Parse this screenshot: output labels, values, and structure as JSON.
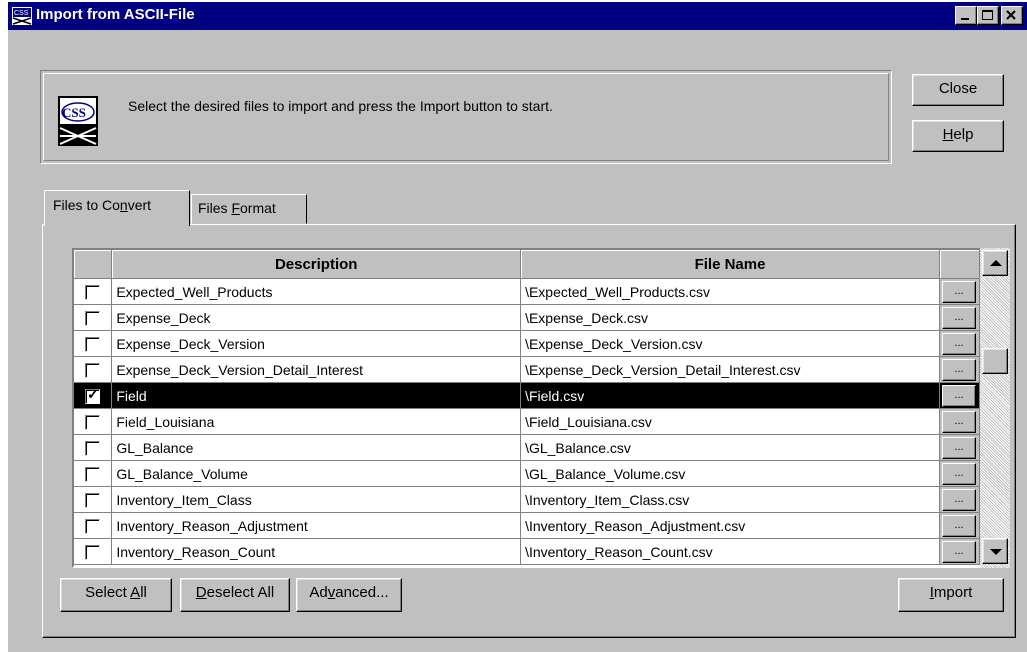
{
  "window": {
    "title": "Import from ASCII-File",
    "minimize_label": "_",
    "maximize_label": "□",
    "close_label": "×"
  },
  "header": {
    "message": "Select the desired files to import and press the Import button to start.",
    "logo_icon": "company-logo-icon"
  },
  "buttons": {
    "close": "Close",
    "help_prefix": "",
    "help_accel": "H",
    "help_rest": "elp",
    "select_all_prefix": "Select ",
    "select_all_accel": "A",
    "select_all_rest": "ll",
    "deselect_all_prefix": "",
    "deselect_all_accel": "D",
    "deselect_all_rest": "eselect All",
    "advanced_prefix": "Ad",
    "advanced_accel": "v",
    "advanced_rest": "anced...",
    "import_prefix": "",
    "import_accel": "I",
    "import_rest": "mport"
  },
  "tabs": [
    {
      "prefix": "Files to Co",
      "accel": "n",
      "rest": "vert",
      "active": true
    },
    {
      "prefix": "Files ",
      "accel": "F",
      "rest": "ormat",
      "active": false
    }
  ],
  "table": {
    "columns": [
      "",
      "Description",
      "File Name",
      ""
    ],
    "browse_label": "...",
    "rows": [
      {
        "checked": false,
        "description": "Expected_Well_Products",
        "file": "\\Expected_Well_Products.csv",
        "selected": false
      },
      {
        "checked": false,
        "description": "Expense_Deck",
        "file": "\\Expense_Deck.csv",
        "selected": false
      },
      {
        "checked": false,
        "description": "Expense_Deck_Version",
        "file": "\\Expense_Deck_Version.csv",
        "selected": false
      },
      {
        "checked": false,
        "description": "Expense_Deck_Version_Detail_Interest",
        "file": "\\Expense_Deck_Version_Detail_Interest.csv",
        "selected": false
      },
      {
        "checked": true,
        "description": "Field",
        "file": "\\Field.csv",
        "selected": true
      },
      {
        "checked": false,
        "description": "Field_Louisiana",
        "file": "\\Field_Louisiana.csv",
        "selected": false
      },
      {
        "checked": false,
        "description": "GL_Balance",
        "file": "\\GL_Balance.csv",
        "selected": false
      },
      {
        "checked": false,
        "description": "GL_Balance_Volume",
        "file": "\\GL_Balance_Volume.csv",
        "selected": false
      },
      {
        "checked": false,
        "description": "Inventory_Item_Class",
        "file": "\\Inventory_Item_Class.csv",
        "selected": false
      },
      {
        "checked": false,
        "description": "Inventory_Reason_Adjustment",
        "file": "\\Inventory_Reason_Adjustment.csv",
        "selected": false
      },
      {
        "checked": false,
        "description": "Inventory_Reason_Count",
        "file": "\\Inventory_Reason_Count.csv",
        "selected": false
      }
    ]
  }
}
